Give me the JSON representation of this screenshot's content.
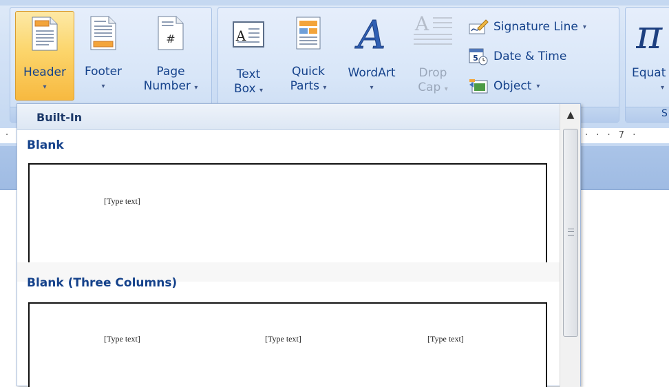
{
  "ribbon": {
    "header_footer": {
      "header": {
        "label": "Header",
        "arrow": "▾"
      },
      "footer": {
        "label": "Footer",
        "arrow": "▾"
      },
      "page_number": {
        "label1": "Page",
        "label2": "Number",
        "arrow": "▾"
      }
    },
    "text": {
      "text_box": {
        "label1": "Text",
        "label2": "Box",
        "arrow": "▾"
      },
      "quick_parts": {
        "label1": "Quick",
        "label2": "Parts",
        "arrow": "▾"
      },
      "wordart": {
        "label": "WordArt",
        "arrow": "▾"
      },
      "drop_cap": {
        "label1": "Drop",
        "label2": "Cap",
        "arrow": "▾"
      },
      "signature_line": {
        "label": "Signature Line",
        "arrow": "▾"
      },
      "date_time": {
        "label": "Date & Time"
      },
      "object": {
        "label": "Object",
        "arrow": "▾"
      }
    },
    "symbols": {
      "equation": {
        "label": "Equat",
        "arrow": "▾",
        "group_label_fragment": "S"
      }
    }
  },
  "ruler": {
    "marks": "· · · 7 ·",
    "left_mark": "·"
  },
  "gallery": {
    "section_header": "Built-In",
    "items": [
      {
        "title": "Blank",
        "placeholders": [
          "[Type text]"
        ]
      },
      {
        "title": "Blank (Three Columns)",
        "placeholders": [
          "[Type text]",
          "[Type text]",
          "[Type text]"
        ]
      }
    ]
  },
  "colors": {
    "ribbon_text": "#15428b",
    "active_button": "#fcd56b",
    "ribbon_background": "#d3e2f6"
  }
}
